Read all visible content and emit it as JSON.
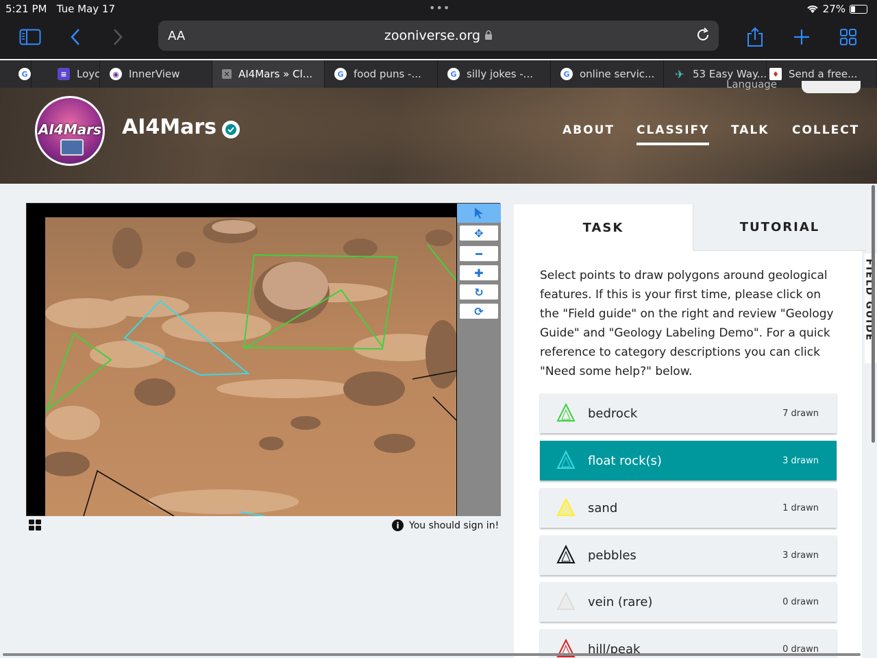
{
  "status": {
    "time": "5:21 PM",
    "date": "Tue May 17",
    "battery_text": "27%",
    "battery_level": 0.27
  },
  "browser": {
    "aa": "AA",
    "url": "zooniverse.org"
  },
  "tabs": [
    {
      "label": "",
      "favicon": "G"
    },
    {
      "label": "Loyc",
      "favicon": "list"
    },
    {
      "label": "InnerView",
      "favicon": "innerview"
    },
    {
      "label": "AI4Mars » Cl...",
      "favicon": "close",
      "active": true
    },
    {
      "label": "food puns -...",
      "favicon": "G"
    },
    {
      "label": "silly jokes -...",
      "favicon": "G"
    },
    {
      "label": "online servic...",
      "favicon": "G"
    },
    {
      "label": "53 Easy Way...",
      "favicon": "plane"
    },
    {
      "label": "Send a free...",
      "favicon": "red"
    }
  ],
  "project": {
    "logo_text": "AI4Mars",
    "title": "AI4Mars",
    "language_ghost": "Language"
  },
  "nav": {
    "about": "ABOUT",
    "classify": "CLASSIFY",
    "talk": "TALK",
    "collect": "COLLECT"
  },
  "viewer": {
    "signin": "You should sign in!"
  },
  "panel": {
    "tab_task": "TASK",
    "tab_tutorial": "TUTORIAL",
    "instructions": "Select points to draw polygons around geological features. If this is your first time, please click on the \"Field guide\" on the right and review \"Geology Guide\" and \"Geology Labeling Demo\". For a quick reference to category descriptions you can click \"Need some help?\" below.",
    "field_guide": "FIELD GUIDE",
    "choices": [
      {
        "label": "bedrock",
        "count": "7 drawn",
        "color": "#3fd13f"
      },
      {
        "label": "float rock(s)",
        "count": "3 drawn",
        "color": "#38d9e6",
        "selected": true
      },
      {
        "label": "sand",
        "count": "1 drawn",
        "color": "#ffee33"
      },
      {
        "label": "pebbles",
        "count": "3 drawn",
        "color": "#111111"
      },
      {
        "label": "vein (rare)",
        "count": "0 drawn",
        "color": "#dddddd"
      },
      {
        "label": "hill/peak",
        "count": "0 drawn",
        "color": "#e02020"
      }
    ]
  },
  "colors": {
    "accent": "#00979d",
    "link_blue": "#1f74d6"
  }
}
